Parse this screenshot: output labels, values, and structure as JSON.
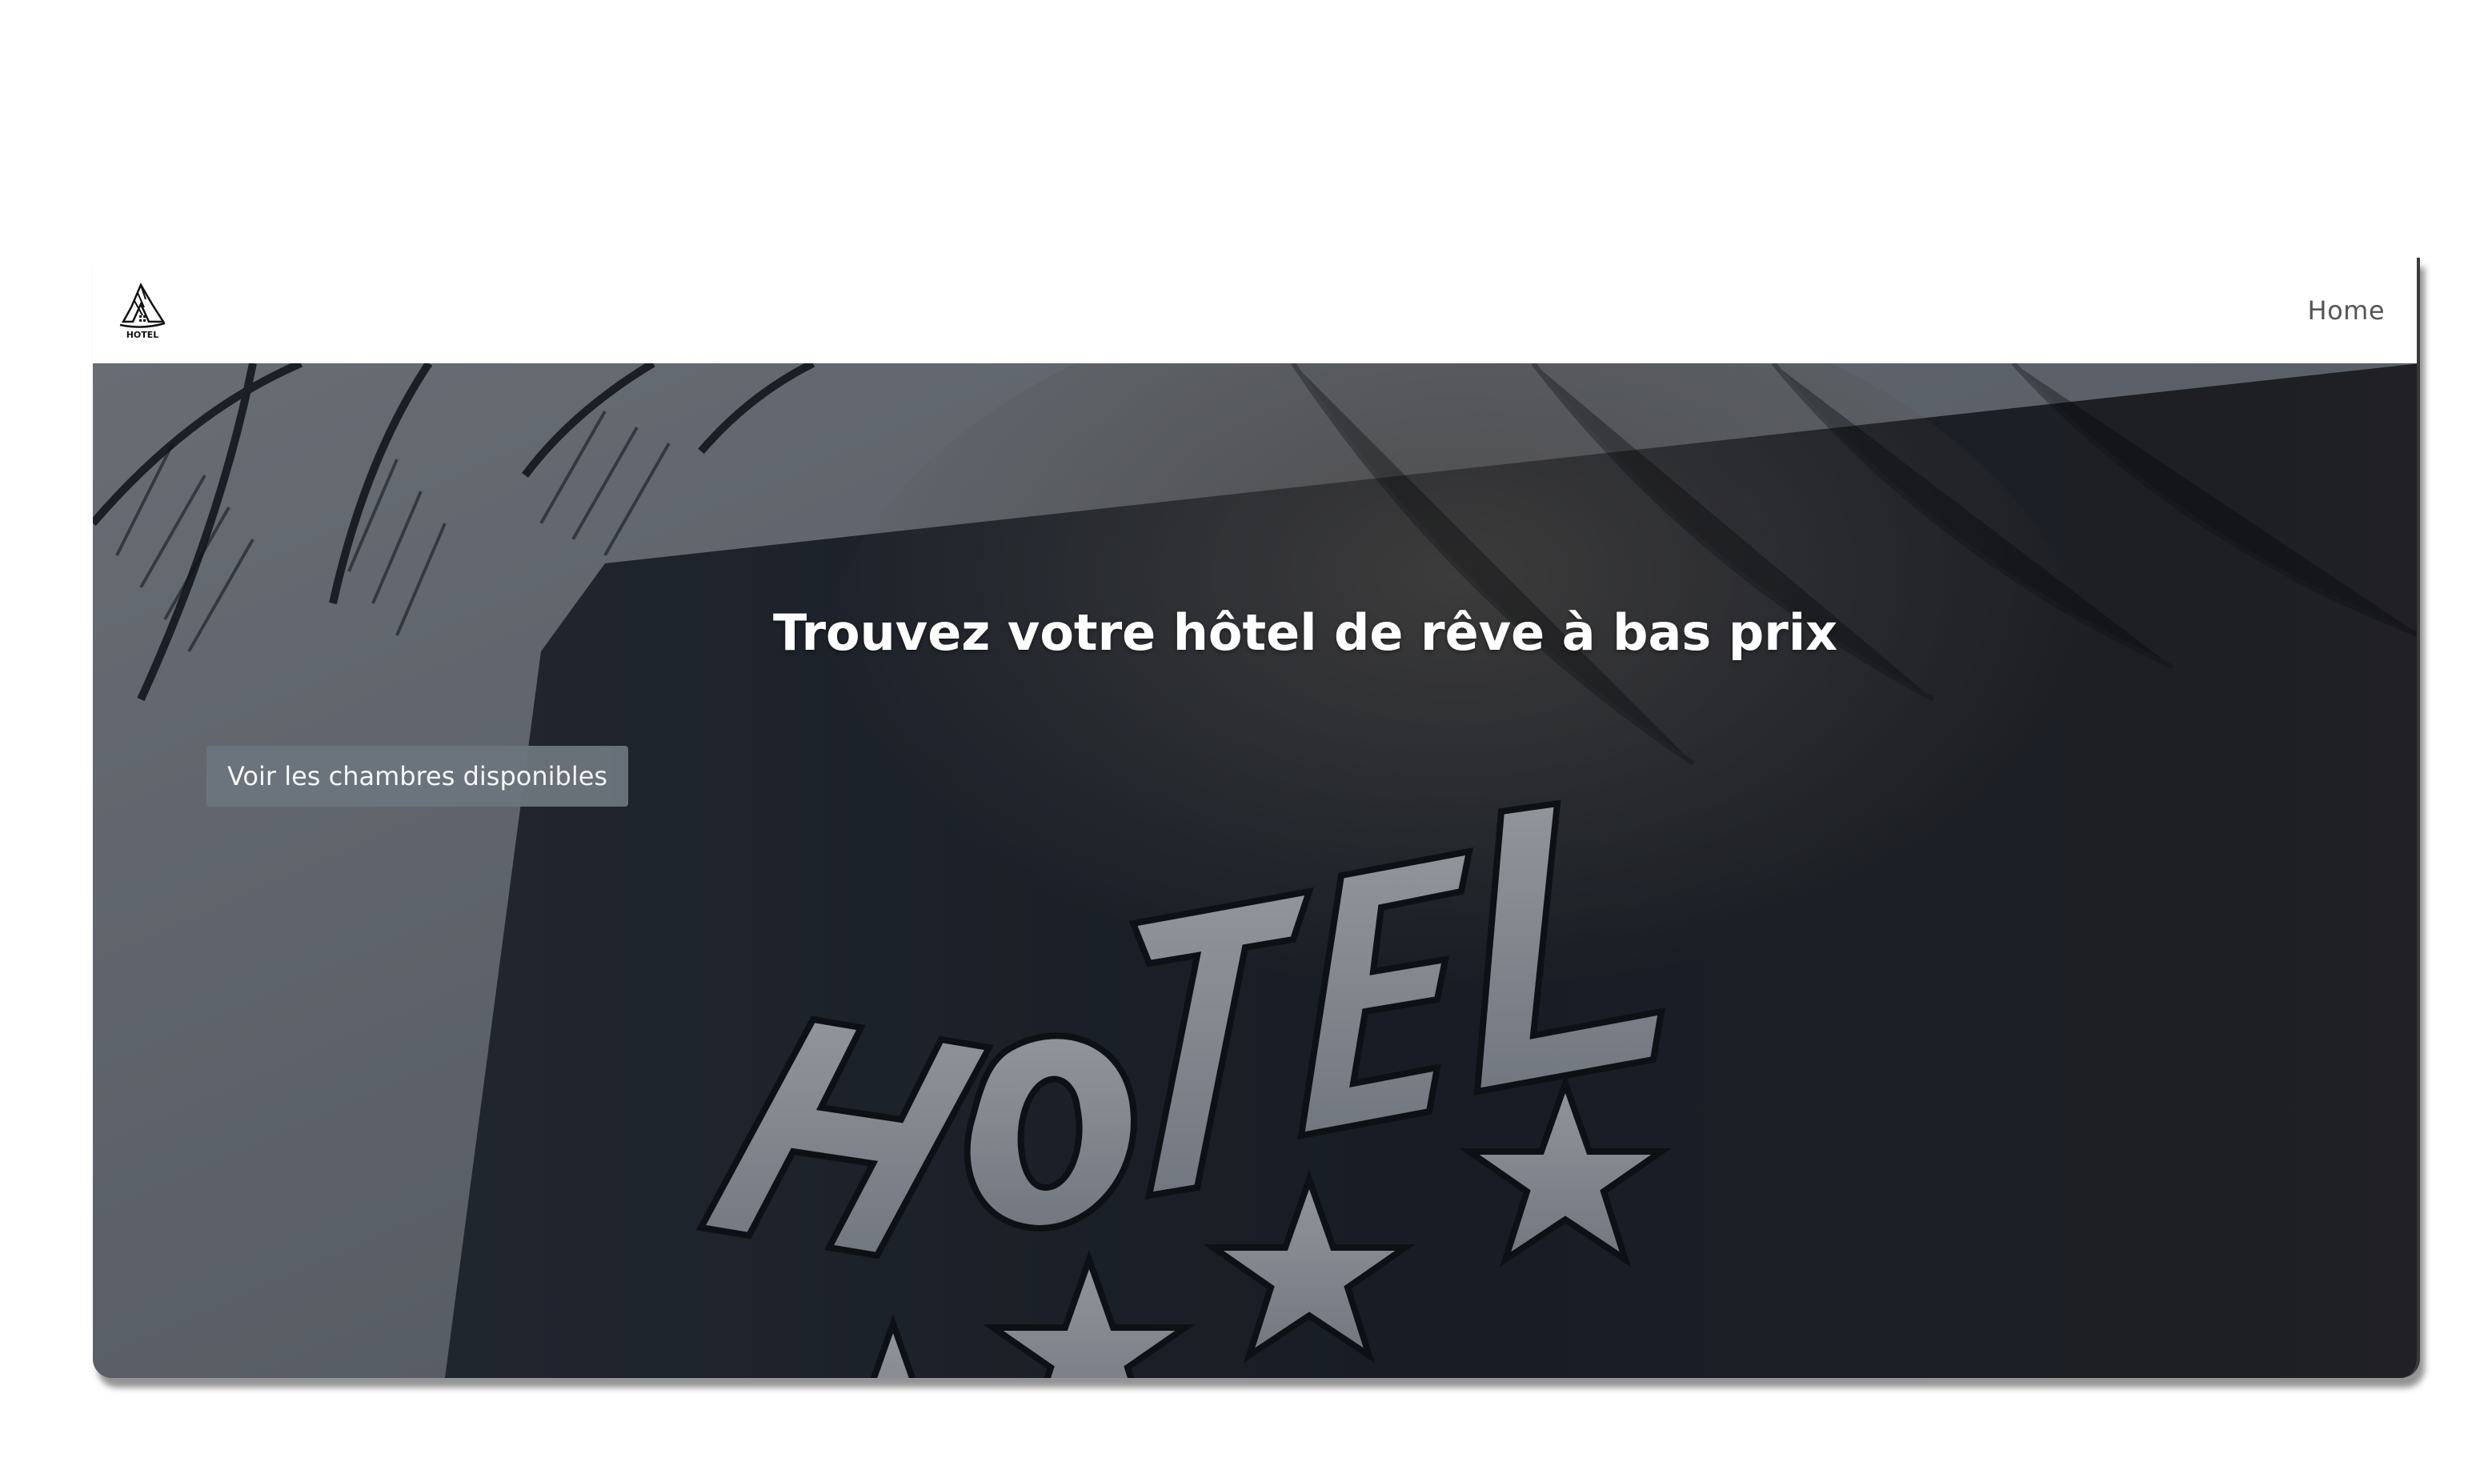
{
  "navbar": {
    "logo_text": "HOTEL",
    "home_label": "Home"
  },
  "hero": {
    "title": "Trouvez votre hôtel de rêve à bas prix",
    "cta_label": "Voir les chambres disponibles",
    "sign_text": "HOTEL"
  },
  "colors": {
    "button_bg": "#6c757d",
    "hero_overlay": "#1c222b",
    "nav_text": "#555555"
  }
}
